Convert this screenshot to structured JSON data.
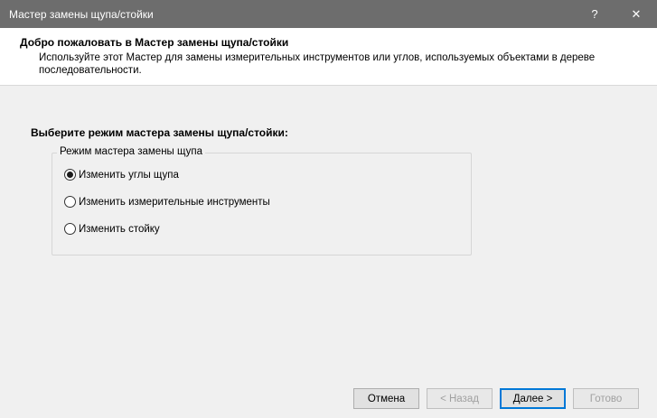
{
  "window": {
    "title": "Мастер замены щупа/стойки",
    "help_label": "?",
    "close_label": "✕"
  },
  "header": {
    "title": "Добро пожаловать в Мастер замены щупа/стойки",
    "description": "Используйте этот Мастер для замены измерительных инструментов или углов, используемых объектами в дереве последовательности."
  },
  "main": {
    "prompt": "Выберите режим мастера замены щупа/стойки:",
    "group_label": "Режим мастера замены щупа",
    "options": [
      {
        "label": "Изменить углы щупа",
        "checked": true
      },
      {
        "label": "Изменить измерительные инструменты",
        "checked": false
      },
      {
        "label": "Изменить стойку",
        "checked": false
      }
    ]
  },
  "footer": {
    "cancel_label": "Отмена",
    "back_label": "< Назад",
    "next_label": "Далее >",
    "finish_label": "Готово"
  }
}
